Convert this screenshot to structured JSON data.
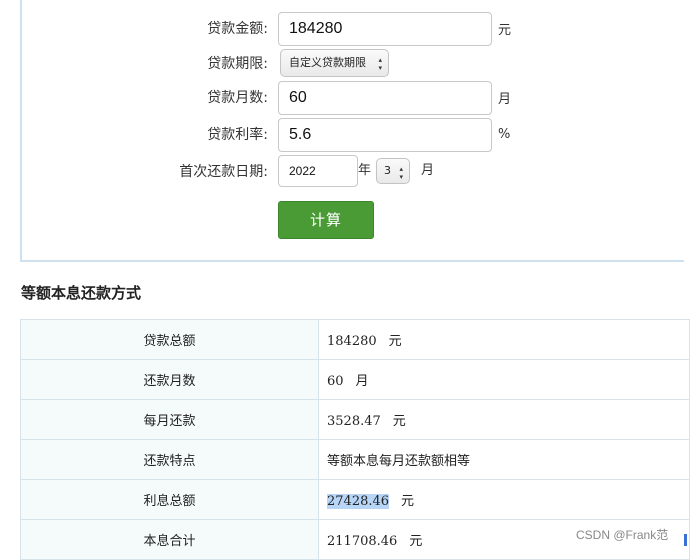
{
  "form": {
    "loan_amount": {
      "label": "贷款金额:",
      "value": "184280",
      "unit": "元"
    },
    "loan_term": {
      "label": "贷款期限:",
      "selected": "自定义贷款期限"
    },
    "loan_months": {
      "label": "贷款月数:",
      "value": "60",
      "unit": "月"
    },
    "interest_rate": {
      "label": "贷款利率:",
      "value": "5.6",
      "unit": "%"
    },
    "first_payment_date": {
      "label": "首次还款日期:",
      "year": "2022",
      "year_unit": "年",
      "month": "3",
      "month_unit": "月"
    },
    "calculate_label": "计算"
  },
  "results": {
    "title": "等额本息还款方式",
    "rows": [
      {
        "key": "贷款总额",
        "value": "184280",
        "unit": "元"
      },
      {
        "key": "还款月数",
        "value": "60",
        "unit": "月"
      },
      {
        "key": "每月还款",
        "value": "3528.47",
        "unit": "元"
      },
      {
        "key": "还款特点",
        "value": "等额本息每月还款额相等",
        "unit": ""
      },
      {
        "key": "利息总额",
        "value": "27428.46",
        "unit": "元"
      },
      {
        "key": "本息合计",
        "value": "211708.46",
        "unit": "元"
      }
    ]
  },
  "watermark": "CSDN @Frank范",
  "colors": {
    "button": "#4a9a35",
    "panel_border": "#cfe0ee",
    "key_cell_bg": "#f5fbfb",
    "selection": "#b7d5f7"
  }
}
